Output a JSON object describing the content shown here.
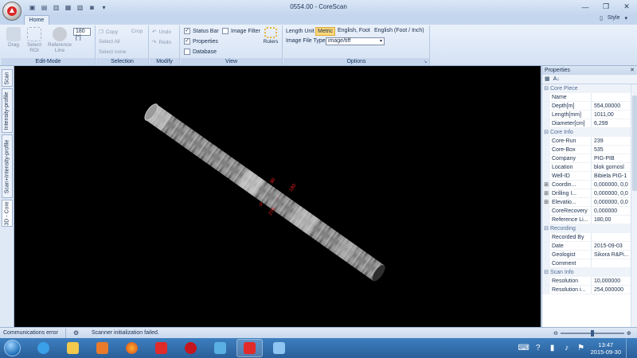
{
  "window": {
    "title": "0554.00 - CoreScan"
  },
  "ribbon_tabs": {
    "home": "Home",
    "style_menu": "Style"
  },
  "edit_mode": {
    "drag": "Drag",
    "select_roi": "Select ROI",
    "reference_line": "Reference Line",
    "angle_value": "180 [°]",
    "label": "Edit-Mode"
  },
  "selection": {
    "copy": "Copy",
    "crop": "Crop",
    "select_all": "Select All",
    "select_none": "Select none",
    "label": "Selection"
  },
  "modify": {
    "undo": "Undo",
    "redo": "Redo",
    "label": "Modify"
  },
  "view": {
    "status_bar": "Status Bar",
    "image_filter": "Image Filter",
    "properties": "Properties",
    "database": "Database",
    "rulers": "Rulers",
    "label": "View",
    "status_bar_checked": true,
    "properties_checked": true,
    "image_filter_checked": false,
    "database_checked": false
  },
  "options": {
    "length_unit_label": "Length Unit",
    "unit_metric": "Metric",
    "unit_english_foot": "English, Foot",
    "unit_english_foot_inch": "English (Foot / Inch)",
    "image_file_types_label": "Image File Types",
    "image_file_type_value": "image/tiff",
    "label": "Options"
  },
  "left_tabs": [
    "Scan",
    "Intensity-profile",
    "Scan+Intensity-profile",
    "3D - Core"
  ],
  "viewport": {
    "labels": [
      "0",
      "90",
      "180",
      "270"
    ]
  },
  "properties": {
    "title": "Properties",
    "categories": [
      {
        "name": "Core Piece",
        "rows": [
          {
            "key": "Name",
            "value": ""
          },
          {
            "key": "Depth[m]",
            "value": "554,00000"
          },
          {
            "key": "Length[mm]",
            "value": "1011,00"
          },
          {
            "key": "Diameter[cm]",
            "value": "6,299"
          }
        ]
      },
      {
        "name": "Core Info",
        "rows": [
          {
            "key": "Core-Run",
            "value": "239"
          },
          {
            "key": "Core-Box",
            "value": "535"
          },
          {
            "key": "Company",
            "value": "PIG-PIB"
          },
          {
            "key": "Location",
            "value": "blok gornosl"
          },
          {
            "key": "Well-ID",
            "value": "Bibiela PIG-1"
          },
          {
            "key": "Coordin...",
            "value": "0,000000, 0,0",
            "expand": "⊞"
          },
          {
            "key": "Drilling I...",
            "value": "0,000000, 0,0",
            "expand": "⊞"
          },
          {
            "key": "Elevatio...",
            "value": "0,000000, 0,0",
            "expand": "⊞"
          },
          {
            "key": "CoreRecovery",
            "value": "0,000000"
          },
          {
            "key": "Reference Li...",
            "value": "180,00"
          }
        ]
      },
      {
        "name": "Recording",
        "rows": [
          {
            "key": "Recorded By",
            "value": ""
          },
          {
            "key": "Date",
            "value": "2015-09-03"
          },
          {
            "key": "Geologist",
            "value": "Sikora R&Pi..."
          },
          {
            "key": "Comment",
            "value": ""
          }
        ]
      },
      {
        "name": "Scan Info",
        "rows": [
          {
            "key": "Resolution",
            "value": "10,000000"
          },
          {
            "key": "Resolution i...",
            "value": "254,000000"
          }
        ]
      }
    ]
  },
  "status": {
    "comm": "Communications error",
    "scanner": "Scanner initialization failed."
  },
  "taskbar": {
    "time": "13:47",
    "date": "2015-09-30"
  },
  "colors": {
    "viewport_bg": "#000000",
    "accent_red": "#ff1e1e",
    "taskbar": "#2f6aa8"
  }
}
